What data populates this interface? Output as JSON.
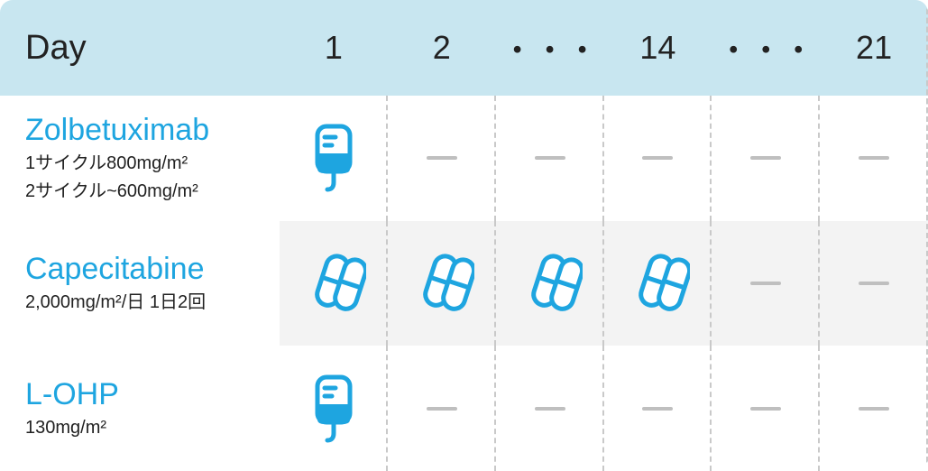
{
  "header": {
    "label": "Day",
    "days": [
      "1",
      "2",
      "・・・",
      "14",
      "・・・",
      "21"
    ]
  },
  "rows": [
    {
      "name": "Zolbetuximab",
      "dose_lines": [
        "1サイクル800mg/m²",
        "2サイクル~600mg/m²"
      ],
      "cells": [
        "iv",
        "dash",
        "dash",
        "dash",
        "dash",
        "dash"
      ]
    },
    {
      "name": "Capecitabine",
      "dose_lines": [
        "2,000mg/m²/日 1日2回"
      ],
      "cells": [
        "pill",
        "pill",
        "pill",
        "pill",
        "dash",
        "dash"
      ]
    },
    {
      "name": "L-OHP",
      "dose_lines": [
        "130mg/m²"
      ],
      "cells": [
        "iv",
        "dash",
        "dash",
        "dash",
        "dash",
        "dash"
      ]
    }
  ],
  "colors": {
    "accent": "#1ea5e0"
  }
}
